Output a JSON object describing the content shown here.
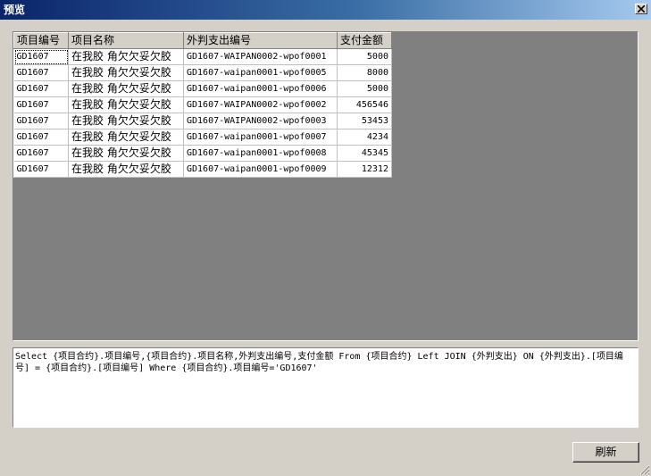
{
  "window": {
    "title": "预览",
    "close_icon": "close-icon"
  },
  "table": {
    "columns": [
      "项目编号",
      "项目名称",
      "外判支出编号",
      "支付金额"
    ],
    "rows": [
      [
        "GD1607",
        "在我胶 角欠欠妥欠胶",
        "GD1607-WAIPAN0002-wpof0001",
        "5000"
      ],
      [
        "GD1607",
        "在我胶 角欠欠妥欠胶",
        "GD1607-waipan0001-wpof0005",
        "8000"
      ],
      [
        "GD1607",
        "在我胶 角欠欠妥欠胶",
        "GD1607-waipan0001-wpof0006",
        "5000"
      ],
      [
        "GD1607",
        "在我胶 角欠欠妥欠胶",
        "GD1607-WAIPAN0002-wpof0002",
        "456546"
      ],
      [
        "GD1607",
        "在我胶 角欠欠妥欠胶",
        "GD1607-WAIPAN0002-wpof0003",
        "53453"
      ],
      [
        "GD1607",
        "在我胶 角欠欠妥欠胶",
        "GD1607-waipan0001-wpof0007",
        "4234"
      ],
      [
        "GD1607",
        "在我胶 角欠欠妥欠胶",
        "GD1607-waipan0001-wpof0008",
        "45345"
      ],
      [
        "GD1607",
        "在我胶 角欠欠妥欠胶",
        "GD1607-waipan0001-wpof0009",
        "12312"
      ]
    ]
  },
  "sql": "Select  {项目合约}.项目编号,{项目合约}.项目名称,外判支出编号,支付金额 From {项目合约} Left JOIN {外判支出} ON {外判支出}.[项目编号] = {项目合约}.[项目编号] Where {项目合约}.项目编号='GD1607'",
  "buttons": {
    "refresh_label": "刷新"
  },
  "colors": {
    "titlebar_start": "#0a246a",
    "titlebar_end": "#a6caf0",
    "dialog_bg": "#d4d0c8",
    "grid_empty_bg": "#808080"
  }
}
